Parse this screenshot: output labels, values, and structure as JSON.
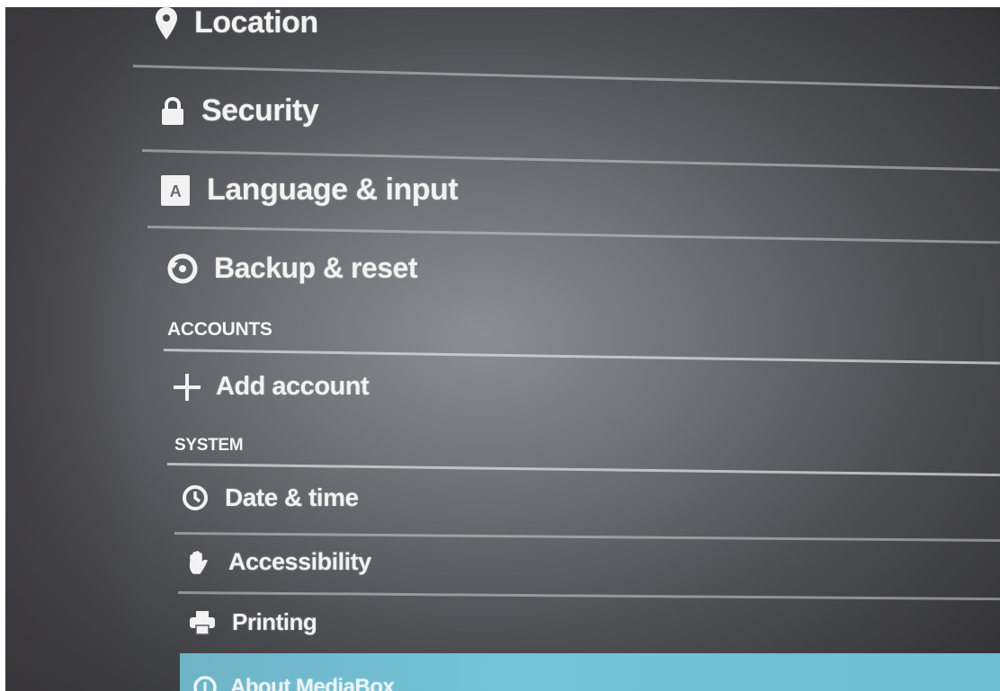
{
  "settings": {
    "items": [
      {
        "label": "Location",
        "icon": "location-pin-icon"
      },
      {
        "label": "Security",
        "icon": "lock-icon"
      },
      {
        "label": "Language & input",
        "icon": "keyboard-language-icon"
      },
      {
        "label": "Backup & reset",
        "icon": "backup-restore-icon"
      }
    ],
    "accounts": {
      "header": "ACCOUNTS",
      "items": [
        {
          "label": "Add account",
          "icon": "plus-icon"
        }
      ]
    },
    "system": {
      "header": "SYSTEM",
      "items": [
        {
          "label": "Date & time",
          "icon": "clock-icon"
        },
        {
          "label": "Accessibility",
          "icon": "hand-icon"
        },
        {
          "label": "Printing",
          "icon": "printer-icon"
        },
        {
          "label": "About MediaBox",
          "icon": "info-icon",
          "selected": true
        }
      ]
    },
    "colors": {
      "background": "#5c5d61",
      "selected_highlight": "#74c4d8",
      "text": "#f2f2f2"
    }
  }
}
